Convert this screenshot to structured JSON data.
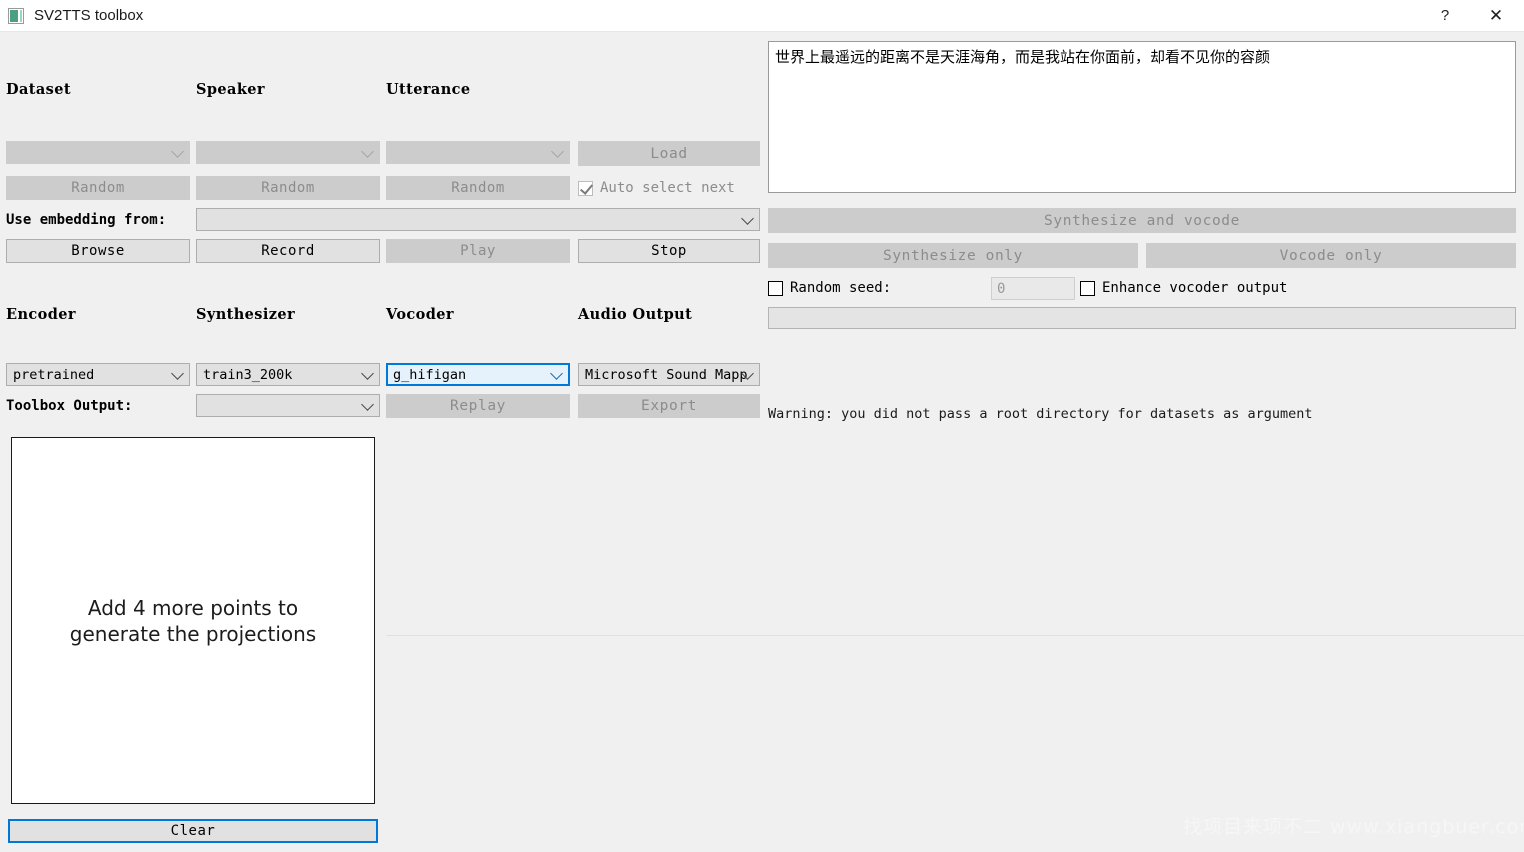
{
  "window": {
    "title": "SV2TTS toolbox",
    "icon": "app-icon",
    "help_label": "?",
    "close_label": "✕"
  },
  "colors": {
    "accent": "#0078d7",
    "window_bg": "#f0f0f0",
    "widget_bg": "#e1e1e1",
    "disabled_bg": "#cccccc",
    "disabled_fg": "#8c8c8c",
    "focus_fill": "#e5f1fb"
  },
  "selection_panel": {
    "headers": {
      "dataset": "Dataset",
      "speaker": "Speaker",
      "utterance": "Utterance"
    },
    "dataset_value": "",
    "speaker_value": "",
    "utterance_value": "",
    "load_label": "Load",
    "random_dataset_label": "Random",
    "random_speaker_label": "Random",
    "random_utterance_label": "Random",
    "auto_select_label": "Auto select next",
    "auto_select_checked": true
  },
  "embedding_panel": {
    "label": "Use embedding from:",
    "value": "",
    "browse_label": "Browse",
    "record_label": "Record",
    "play_label": "Play",
    "stop_label": "Stop"
  },
  "model_panel": {
    "headers": {
      "encoder": "Encoder",
      "synthesizer": "Synthesizer",
      "vocoder": "Vocoder",
      "audio_output": "Audio Output"
    },
    "encoder_value": "pretrained",
    "synthesizer_value": "train3_200k",
    "vocoder_value": "g_hifigan",
    "audio_output_value": "Microsoft Sound Mapp",
    "toolbox_output_label": "Toolbox Output:",
    "toolbox_output_value": "",
    "replay_label": "Replay",
    "export_label": "Export"
  },
  "generation_panel": {
    "text_value": "世界上最遥远的距离不是天涯海角，而是我站在你面前，却看不见你的容颜",
    "synthesize_and_vocode_label": "Synthesize and vocode",
    "synthesize_only_label": "Synthesize only",
    "vocode_only_label": "Vocode only",
    "random_seed_label": "Random seed:",
    "random_seed_checked": false,
    "random_seed_value": "0",
    "enhance_label": "Enhance vocoder output",
    "enhance_checked": false,
    "warning_text": "Warning: you did not pass a root directory for datasets as argument"
  },
  "projection_panel": {
    "message": "Add 4 more points to\ngenerate the projections",
    "clear_label": "Clear"
  },
  "watermark": {
    "text": "找项目来项不二  www.xiangbuer.com"
  }
}
